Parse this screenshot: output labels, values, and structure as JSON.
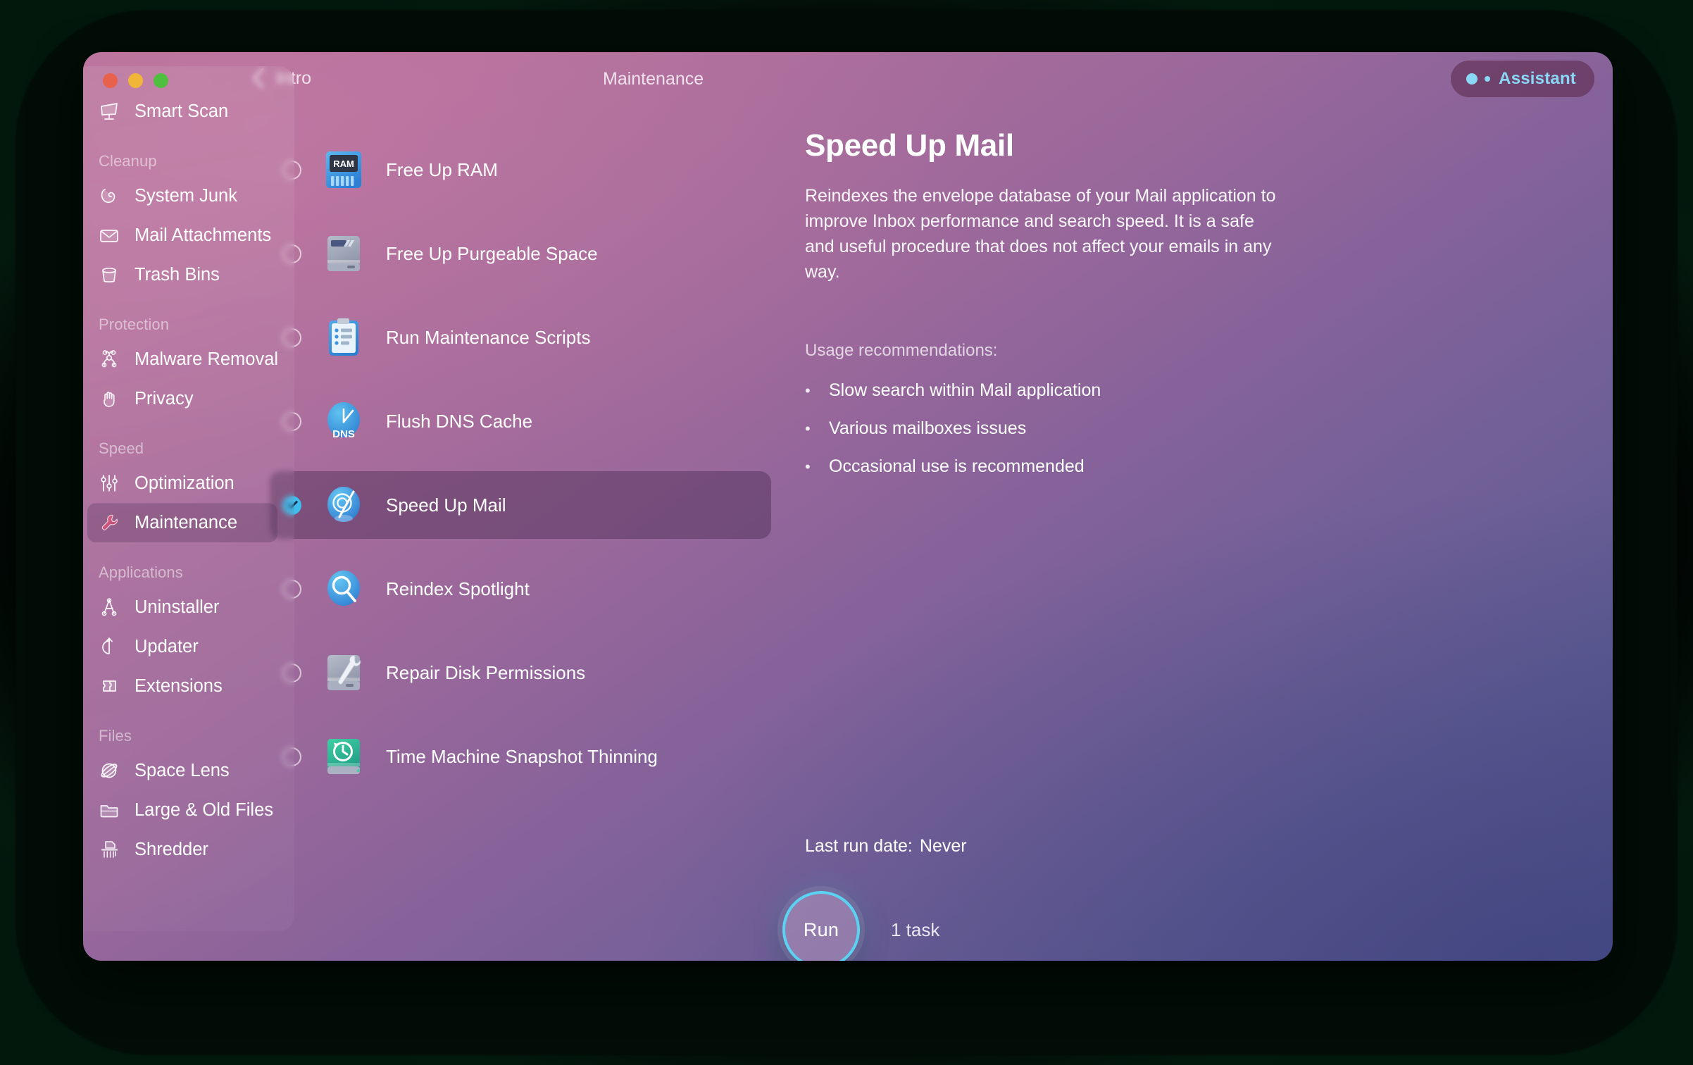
{
  "window": {
    "traffic_lights": [
      {
        "name": "close",
        "color": "#e8614c"
      },
      {
        "name": "minimize",
        "color": "#f0b638"
      },
      {
        "name": "maximize",
        "color": "#4fbf3f"
      }
    ]
  },
  "header": {
    "back_label": "Intro",
    "back_icon": "chevron-left-icon",
    "title": "Maintenance",
    "assistant_label": "Assistant",
    "assistant_accent": "#8ad8f5"
  },
  "sidebar": {
    "top_item": {
      "label": "Smart Scan",
      "icon": "smart-scan-icon"
    },
    "groups": [
      {
        "label": "Cleanup",
        "items": [
          {
            "label": "System Junk",
            "icon": "system-junk-icon"
          },
          {
            "label": "Mail Attachments",
            "icon": "envelope-icon"
          },
          {
            "label": "Trash Bins",
            "icon": "trash-bin-icon"
          }
        ]
      },
      {
        "label": "Protection",
        "items": [
          {
            "label": "Malware Removal",
            "icon": "biohazard-icon"
          },
          {
            "label": "Privacy",
            "icon": "hand-icon"
          }
        ]
      },
      {
        "label": "Speed",
        "items": [
          {
            "label": "Optimization",
            "icon": "sliders-icon"
          },
          {
            "label": "Maintenance",
            "icon": "wrench-icon",
            "selected": true
          }
        ]
      },
      {
        "label": "Applications",
        "items": [
          {
            "label": "Uninstaller",
            "icon": "app-store-a-icon"
          },
          {
            "label": "Updater",
            "icon": "update-arrow-icon"
          },
          {
            "label": "Extensions",
            "icon": "puzzle-piece-icon"
          }
        ]
      },
      {
        "label": "Files",
        "items": [
          {
            "label": "Space Lens",
            "icon": "planet-lens-icon"
          },
          {
            "label": "Large & Old Files",
            "icon": "folder-icon"
          },
          {
            "label": "Shredder",
            "icon": "shredder-icon"
          }
        ]
      }
    ]
  },
  "tasks": [
    {
      "label": "Free Up RAM",
      "icon": "ram-chip-icon",
      "checked": false
    },
    {
      "label": "Free Up Purgeable Space",
      "icon": "hard-drive-icon",
      "checked": false
    },
    {
      "label": "Run Maintenance Scripts",
      "icon": "clipboard-icon",
      "checked": false
    },
    {
      "label": "Flush DNS Cache",
      "icon": "dns-clock-icon",
      "checked": false
    },
    {
      "label": "Speed Up Mail",
      "icon": "mail-speed-icon",
      "checked": true,
      "selected": true
    },
    {
      "label": "Reindex Spotlight",
      "icon": "spotlight-search-icon",
      "checked": false
    },
    {
      "label": "Repair Disk Permissions",
      "icon": "disk-wrench-icon",
      "checked": false
    },
    {
      "label": "Time Machine Snapshot Thinning",
      "icon": "time-machine-icon",
      "checked": false
    }
  ],
  "detail": {
    "title": "Speed Up Mail",
    "description": "Reindexes the envelope database of your Mail application to improve Inbox performance and search speed. It is a safe and useful procedure that does not affect your emails in any way.",
    "usage_title": "Usage recommendations:",
    "usage_items": [
      "Slow search within Mail application",
      "Various mailboxes issues",
      "Occasional use is recommended"
    ],
    "last_run_label": "Last run date:",
    "last_run_value": "Never"
  },
  "footer": {
    "run_label": "Run",
    "task_count_label": "1 task",
    "run_ring_color": "#5cd2f2"
  }
}
